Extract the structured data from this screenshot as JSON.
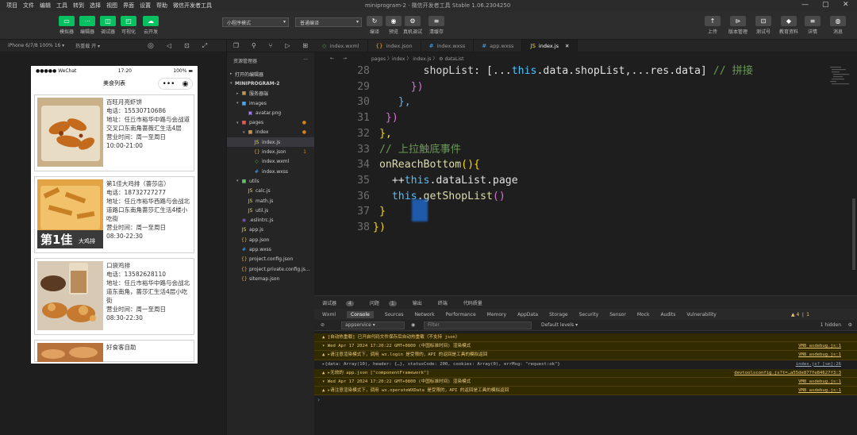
{
  "menu": {
    "items": [
      "项目",
      "文件",
      "编辑",
      "工具",
      "转到",
      "选择",
      "视图",
      "界面",
      "设置",
      "帮助",
      "微信开发者工具"
    ],
    "window_title": "miniprogram-2 · 微信开发者工具 Stable 1.06.2304250"
  },
  "toolbar": {
    "left_buttons": [
      {
        "label": "模拟器",
        "icon": "▭"
      },
      {
        "label": "编辑器",
        "icon": "⋯"
      },
      {
        "label": "调试器",
        "icon": "◫"
      },
      {
        "label": "可视化",
        "icon": "◰"
      },
      {
        "label": "云开发",
        "icon": "☁"
      }
    ],
    "mode_select": "小程序模式",
    "compile_select": "普通编译",
    "center_buttons": [
      {
        "label": "编译",
        "icon": "↻"
      },
      {
        "label": "预览",
        "icon": "◉"
      },
      {
        "label": "真机调试",
        "icon": "⚙"
      },
      {
        "label": "清缓存",
        "icon": "≡"
      }
    ],
    "right_buttons": [
      {
        "label": "上传",
        "icon": "↑"
      },
      {
        "label": "版本管理",
        "icon": "⊳"
      },
      {
        "label": "测试号",
        "icon": "⊡"
      },
      {
        "label": "教育资料",
        "icon": "◆"
      },
      {
        "label": "详情",
        "icon": "≡"
      },
      {
        "label": "消息",
        "icon": "◍"
      }
    ]
  },
  "simulator": {
    "device": "iPhone 6/7/8 100% 16 ▾",
    "hot_reload": "热重载 开 ▾",
    "status_left": "●●●●● WeChat",
    "status_time": "17:20",
    "status_battery": "100%",
    "page_title": "美食列表",
    "shops": [
      {
        "name": "百旺月亮虾饼",
        "phone": "电话：15530710686",
        "address": "地址：任丘市裕华中路与会战道交叉口东南角蔷薇汇生活4层",
        "hours": "营业时间：周一至周日",
        "time": "10:00-21:00"
      },
      {
        "name": "第1佳大鸡排（蔷莎店）",
        "phone": "电话：18732727277",
        "address": "地址：任丘市裕华西路与会战北道路口东南角蔷莎汇生活4楼小吃街",
        "hours": "营业时间：周一至周日",
        "time": "08:30-22:30"
      },
      {
        "name": "口袋鸡排",
        "phone": "电话：13582628110",
        "address": "地址：任丘市裕华中路与会战北道东南角，蔷莎汇生活4层小吃街",
        "hours": "营业时间：周一至周日",
        "time": "08:30-22:30"
      },
      {
        "name": "好食客自助",
        "phone": "",
        "address": "",
        "hours": "",
        "time": ""
      }
    ],
    "thumb_caption": "第1佳 大鸡排"
  },
  "explorer": {
    "title": "资源管理器",
    "sections": {
      "open_editors": "打开的编辑器",
      "project": "MINIPROGRAM-2"
    },
    "tree": [
      {
        "label": "服务器端",
        "icon": "▸",
        "kind": "folder",
        "color": "#c09553",
        "depth": 1,
        "twisty": "▸"
      },
      {
        "label": "images",
        "icon": "▾",
        "kind": "folder",
        "color": "#42a5f5",
        "depth": 1,
        "twisty": "▾"
      },
      {
        "label": "avatar.png",
        "icon": "▣",
        "kind": "file",
        "color": "#ab7df8",
        "depth": 2,
        "twisty": ""
      },
      {
        "label": "pages",
        "icon": "▾",
        "kind": "folder",
        "color": "#ef5350",
        "depth": 1,
        "twisty": "▾",
        "dot": "●"
      },
      {
        "label": "index",
        "icon": "▾",
        "kind": "folder",
        "color": "#c09553",
        "depth": 2,
        "twisty": "▾",
        "dot": "●"
      },
      {
        "label": "index.js",
        "icon": "JS",
        "kind": "file",
        "color": "#f5de19",
        "depth": 3,
        "twisty": "",
        "active": true
      },
      {
        "label": "index.json",
        "icon": "{}",
        "kind": "file",
        "color": "#f5a623",
        "depth": 3,
        "twisty": "",
        "dot": "1"
      },
      {
        "label": "index.wxml",
        "icon": "◇",
        "kind": "file",
        "color": "#4caf50",
        "depth": 3,
        "twisty": ""
      },
      {
        "label": "index.wxss",
        "icon": "#",
        "kind": "file",
        "color": "#42a5f5",
        "depth": 3,
        "twisty": ""
      },
      {
        "label": "utils",
        "icon": "▾",
        "kind": "folder",
        "color": "#66bb6a",
        "depth": 1,
        "twisty": "▾"
      },
      {
        "label": "calc.js",
        "icon": "JS",
        "kind": "file",
        "color": "#f5de19",
        "depth": 2,
        "twisty": ""
      },
      {
        "label": "math.js",
        "icon": "JS",
        "kind": "file",
        "color": "#f5de19",
        "depth": 2,
        "twisty": ""
      },
      {
        "label": "util.js",
        "icon": "JS",
        "kind": "file",
        "color": "#f5de19",
        "depth": 2,
        "twisty": ""
      },
      {
        "label": ".eslintrc.js",
        "icon": "◉",
        "kind": "file",
        "color": "#7e57c2",
        "depth": 1,
        "twisty": ""
      },
      {
        "label": "app.js",
        "icon": "JS",
        "kind": "file",
        "color": "#f5de19",
        "depth": 1,
        "twisty": ""
      },
      {
        "label": "app.json",
        "icon": "{}",
        "kind": "file",
        "color": "#f5a623",
        "depth": 1,
        "twisty": ""
      },
      {
        "label": "app.wxss",
        "icon": "#",
        "kind": "file",
        "color": "#42a5f5",
        "depth": 1,
        "twisty": ""
      },
      {
        "label": "project.config.json",
        "icon": "{}",
        "kind": "file",
        "color": "#f5a623",
        "depth": 1,
        "twisty": ""
      },
      {
        "label": "project.private.config.js...",
        "icon": "{}",
        "kind": "file",
        "color": "#f5a623",
        "depth": 1,
        "twisty": ""
      },
      {
        "label": "sitemap.json",
        "icon": "{}",
        "kind": "file",
        "color": "#f5a623",
        "depth": 1,
        "twisty": ""
      }
    ]
  },
  "editor": {
    "tabs": [
      {
        "label": "index.wxml",
        "icon": "◇",
        "color": "#4caf50",
        "active": false
      },
      {
        "label": "index.json",
        "icon": "{}",
        "color": "#f5a623",
        "active": false
      },
      {
        "label": "index.wxss",
        "icon": "#",
        "color": "#42a5f5",
        "active": false
      },
      {
        "label": "app.wxss",
        "icon": "#",
        "color": "#42a5f5",
        "active": false
      },
      {
        "label": "index.js",
        "icon": "JS",
        "color": "#f5de19",
        "active": true
      }
    ],
    "breadcrumb": "pages 〉index 〉 index.js 〉 ⚙ dataList",
    "lines": [
      {
        "n": "28",
        "indent": "        ",
        "tokens": [
          {
            "t": "shopList",
            "c": "k-prop"
          },
          {
            "t": ": [...",
            "c": "k-white"
          },
          {
            "t": "this",
            "c": "k-blue"
          },
          {
            "t": ".data.shopList,...res.data] ",
            "c": "k-white"
          },
          {
            "t": "// 拼接",
            "c": "k-comment"
          }
        ]
      },
      {
        "n": "29",
        "indent": "      ",
        "tokens": [
          {
            "t": "})",
            "c": "k-pink"
          }
        ]
      },
      {
        "n": "30",
        "indent": "    ",
        "tokens": [
          {
            "t": "},",
            "c": "k-cyan"
          }
        ]
      },
      {
        "n": "31",
        "indent": "  ",
        "tokens": [
          {
            "t": "})",
            "c": "k-pink"
          }
        ]
      },
      {
        "n": "32",
        "indent": " ",
        "tokens": [
          {
            "t": "},",
            "c": "k-gold"
          }
        ]
      },
      {
        "n": "33",
        "indent": " ",
        "tokens": [
          {
            "t": "// 上拉触底事件",
            "c": "k-comment"
          }
        ]
      },
      {
        "n": "34",
        "indent": " ",
        "tokens": [
          {
            "t": "onReachBottom",
            "c": "k-func"
          },
          {
            "t": "(){",
            "c": "k-gold"
          }
        ]
      },
      {
        "n": "35",
        "indent": "   ",
        "tokens": [
          {
            "t": "++",
            "c": "k-white"
          },
          {
            "t": "this",
            "c": "k-blue"
          },
          {
            "t": ".dataList.page",
            "c": "k-white"
          }
        ]
      },
      {
        "n": "36",
        "indent": "   ",
        "tokens": [
          {
            "t": "this",
            "c": "k-blue"
          },
          {
            "t": ".",
            "c": "k-white"
          },
          {
            "t": "getShopList",
            "c": "k-func"
          },
          {
            "t": "()",
            "c": "k-pink"
          }
        ]
      },
      {
        "n": "37",
        "indent": " ",
        "tokens": [
          {
            "t": "}",
            "c": "k-gold"
          }
        ]
      },
      {
        "n": "38",
        "indent": "",
        "tokens": [
          {
            "t": "})",
            "c": "k-gold"
          }
        ]
      }
    ]
  },
  "devtools": {
    "top_tabs": [
      {
        "label": "调试器",
        "badge": "4"
      },
      {
        "label": "问题",
        "badge": "1"
      },
      {
        "label": "输出",
        "badge": ""
      },
      {
        "label": "终端",
        "badge": ""
      },
      {
        "label": "代码质量",
        "badge": ""
      }
    ],
    "sub_tabs": [
      "Wxml",
      "Console",
      "Sources",
      "Network",
      "Performance",
      "Memory",
      "AppData",
      "Storage",
      "Security",
      "Sensor",
      "Mock",
      "Audits",
      "Vulnerability"
    ],
    "active_sub_tab": "Console",
    "warn_count": "▲ 4 ❘ 1",
    "context": "appservice",
    "filter_placeholder": "Filter",
    "levels": "Default levels ▾",
    "hidden": "1 hidden",
    "logs": [
      {
        "type": "warn",
        "text": "▲ [自动热重载] 已开启代码文件保存后自动热重载（不支持 json）",
        "src": ""
      },
      {
        "type": "warn",
        "text": "  ▾ Wed Apr 17 2024 17:20:22 GMT+0800 (中国标准时间) 渲染模式",
        "src": "VM8 asdebug.js:1"
      },
      {
        "type": "warn",
        "text": "    ▲ ▸请注意渲染模式下，调用 wx.login 是受限的，API 的返回是工具的模拟返回",
        "src": "VM8 asdebug.js:1"
      },
      {
        "type": "info",
        "text": "    ▸{data: Array(10), header: {…}, statusCode: 200, cookies: Array(0), errMsg: \"request:ok\"}",
        "src": "index.js? [sm]:26"
      },
      {
        "type": "warn",
        "text": "▲ ▸无效的 app.json [\"componentFramework\"]",
        "src": "devtoolsconfig.js?t=…a55de877fe84627f3:3"
      },
      {
        "type": "warn",
        "text": "  ▾ Wed Apr 17 2024 17:20:22 GMT+0800 (中国标准时间) 渲染模式",
        "src": "VM8 asdebug.js:1"
      },
      {
        "type": "warn",
        "text": "    ▲ ▸请注意渲染模式下，调用 wx.operateWXData 是受限的，API 的返回是工具的模拟返回",
        "src": "VM8 asdebug.js:1"
      }
    ],
    "prompt": "›"
  }
}
